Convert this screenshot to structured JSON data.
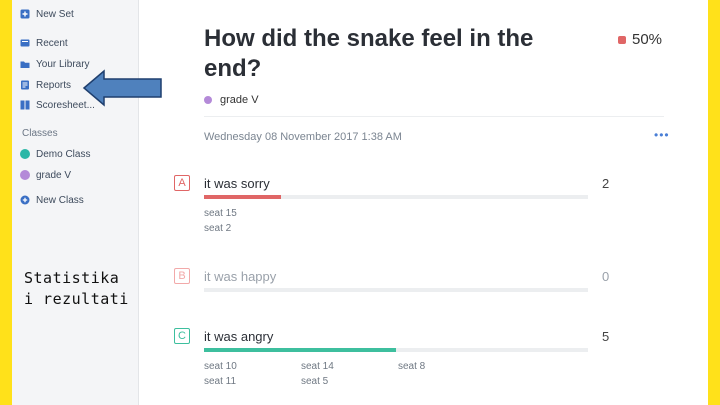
{
  "sidebar": {
    "items": [
      {
        "label": "New Set",
        "icon": "plus-square-icon",
        "color": "#3a6fc4"
      },
      {
        "label": "Recent",
        "icon": "clock-icon",
        "color": "#3a6fc4"
      },
      {
        "label": "Your Library",
        "icon": "folder-icon",
        "color": "#3a6fc4"
      },
      {
        "label": "Reports",
        "icon": "reports-icon",
        "color": "#3a6fc4"
      },
      {
        "label": "Scoresheet...",
        "icon": "scoresheet-icon",
        "color": "#3a6fc4"
      }
    ],
    "classes_label": "Classes",
    "classes": [
      {
        "label": "Demo Class",
        "color": "#2bb7a7"
      },
      {
        "label": "grade V",
        "color": "#b48ad8"
      }
    ],
    "new_class_label": "New Class"
  },
  "caption": {
    "line1": "Statistika",
    "line2": "i rezultati"
  },
  "question": {
    "title": "How did the snake feel in the end?",
    "score": "50%",
    "class_name": "grade V",
    "date": "Wednesday 08 November 2017 1:38 AM",
    "more": "•••"
  },
  "answers": [
    {
      "letter": "A",
      "text": "it was sorry",
      "count": "2",
      "fraction": 0.2,
      "color": "#e06666",
      "correct": false,
      "seats": [
        "seat 15",
        "seat 2"
      ]
    },
    {
      "letter": "B",
      "text": "it was happy",
      "count": "0",
      "fraction": 0.0,
      "color": "#f2a9a9",
      "correct": false,
      "seats": []
    },
    {
      "letter": "C",
      "text": "it was angry",
      "count": "5",
      "fraction": 0.5,
      "color": "#3dbf9e",
      "correct": true,
      "seats": [
        "seat 10",
        "seat 11",
        "seat 14",
        "seat 5",
        "seat 8"
      ]
    }
  ],
  "colors": {
    "frame": "#ffe11a",
    "arrow": "#4f81bd"
  }
}
